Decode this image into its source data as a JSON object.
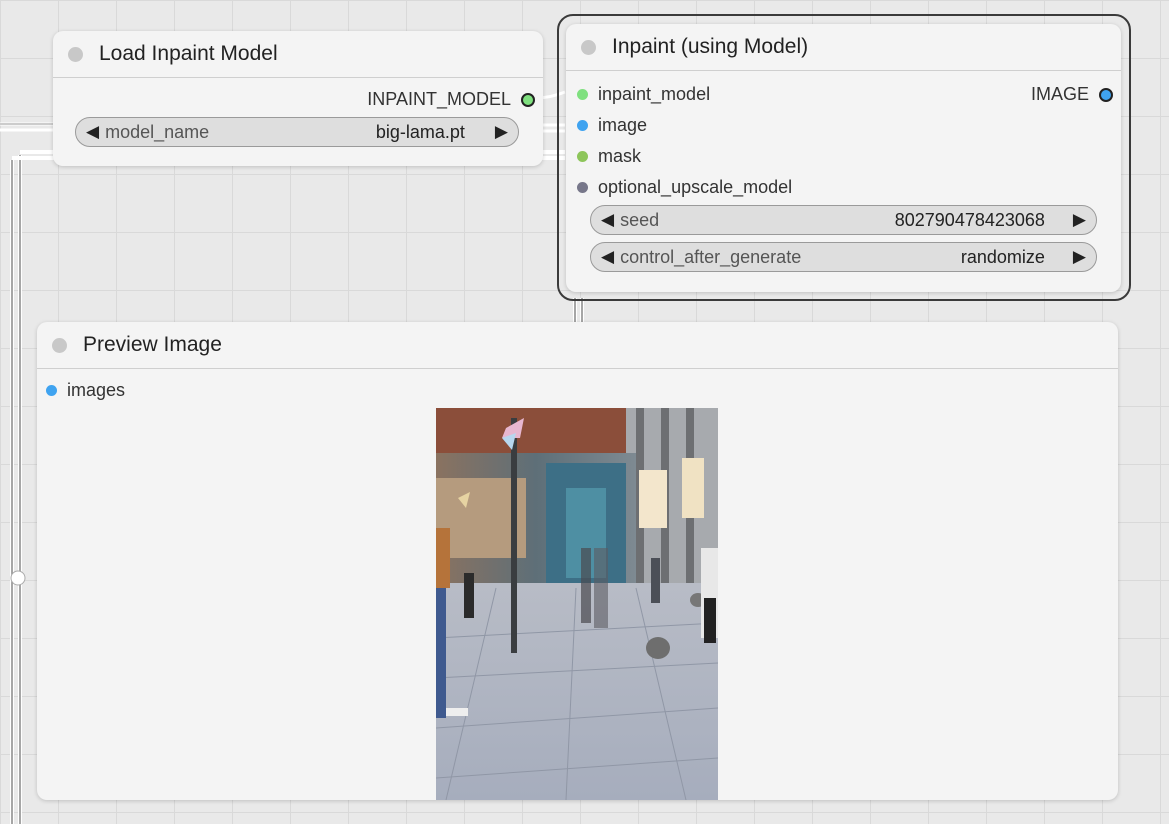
{
  "nodes": {
    "load_inpaint_model": {
      "title": "Load Inpaint Model",
      "output_label": "INPAINT_MODEL",
      "widget": {
        "label": "model_name",
        "value": "big-lama.pt"
      }
    },
    "inpaint": {
      "title": "Inpaint (using Model)",
      "inputs": [
        "inpaint_model",
        "image",
        "mask",
        "optional_upscale_model"
      ],
      "output_label": "IMAGE",
      "widgets": [
        {
          "label": "seed",
          "value": "802790478423068"
        },
        {
          "label": "control_after_generate",
          "value": "randomize"
        }
      ]
    },
    "preview_image": {
      "title": "Preview Image",
      "input_label": "images"
    }
  },
  "colors": {
    "inpaint_model_slot": "#7fe07f",
    "image_slot": "#3fa3f0",
    "mask_slot": "#8dc55a",
    "upscale_model_slot": "#77778a",
    "canvas_bg": "#e9e9e9",
    "node_bg": "#f4f4f4"
  },
  "icons": {
    "left_arrow": "◀",
    "right_arrow": "▶"
  }
}
